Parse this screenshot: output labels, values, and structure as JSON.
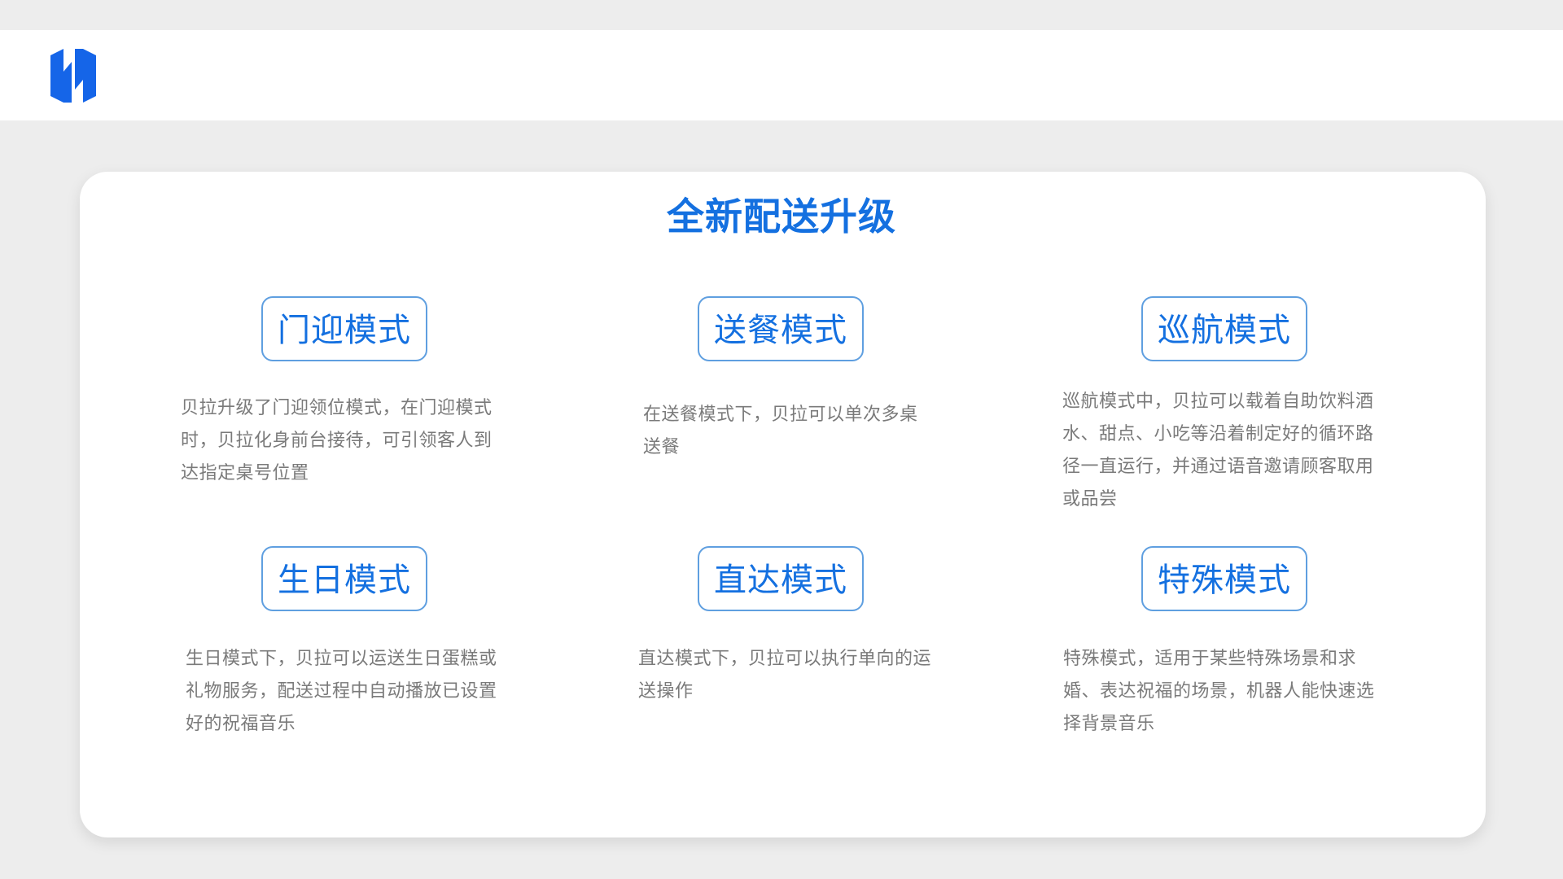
{
  "title": "全新配送升级",
  "modes": [
    {
      "label": "门迎模式",
      "desc": "贝拉升级了门迎领位模式，在门迎模式时，贝拉化身前台接待，可引领客人到达指定桌号位置"
    },
    {
      "label": "送餐模式",
      "desc": "在送餐模式下，贝拉可以单次多桌送餐"
    },
    {
      "label": "巡航模式",
      "desc": "巡航模式中，贝拉可以载着自助饮料酒水、甜点、小吃等沿着制定好的循环路径一直运行，并通过语音邀请顾客取用或品尝"
    },
    {
      "label": "生日模式",
      "desc": "生日模式下，贝拉可以运送生日蛋糕或礼物服务，配送过程中自动播放已设置好的祝福音乐"
    },
    {
      "label": "直达模式",
      "desc": "直达模式下，贝拉可以执行单向的运送操作"
    },
    {
      "label": "特殊模式",
      "desc": "特殊模式，适用于某些特殊场景和求婚、表达祝福的场景，机器人能快速选择背景音乐"
    }
  ],
  "colors": {
    "accent": "#1470e0",
    "border": "#5f9fe0",
    "text_gray": "#7a7a7a",
    "background": "#ededed"
  }
}
